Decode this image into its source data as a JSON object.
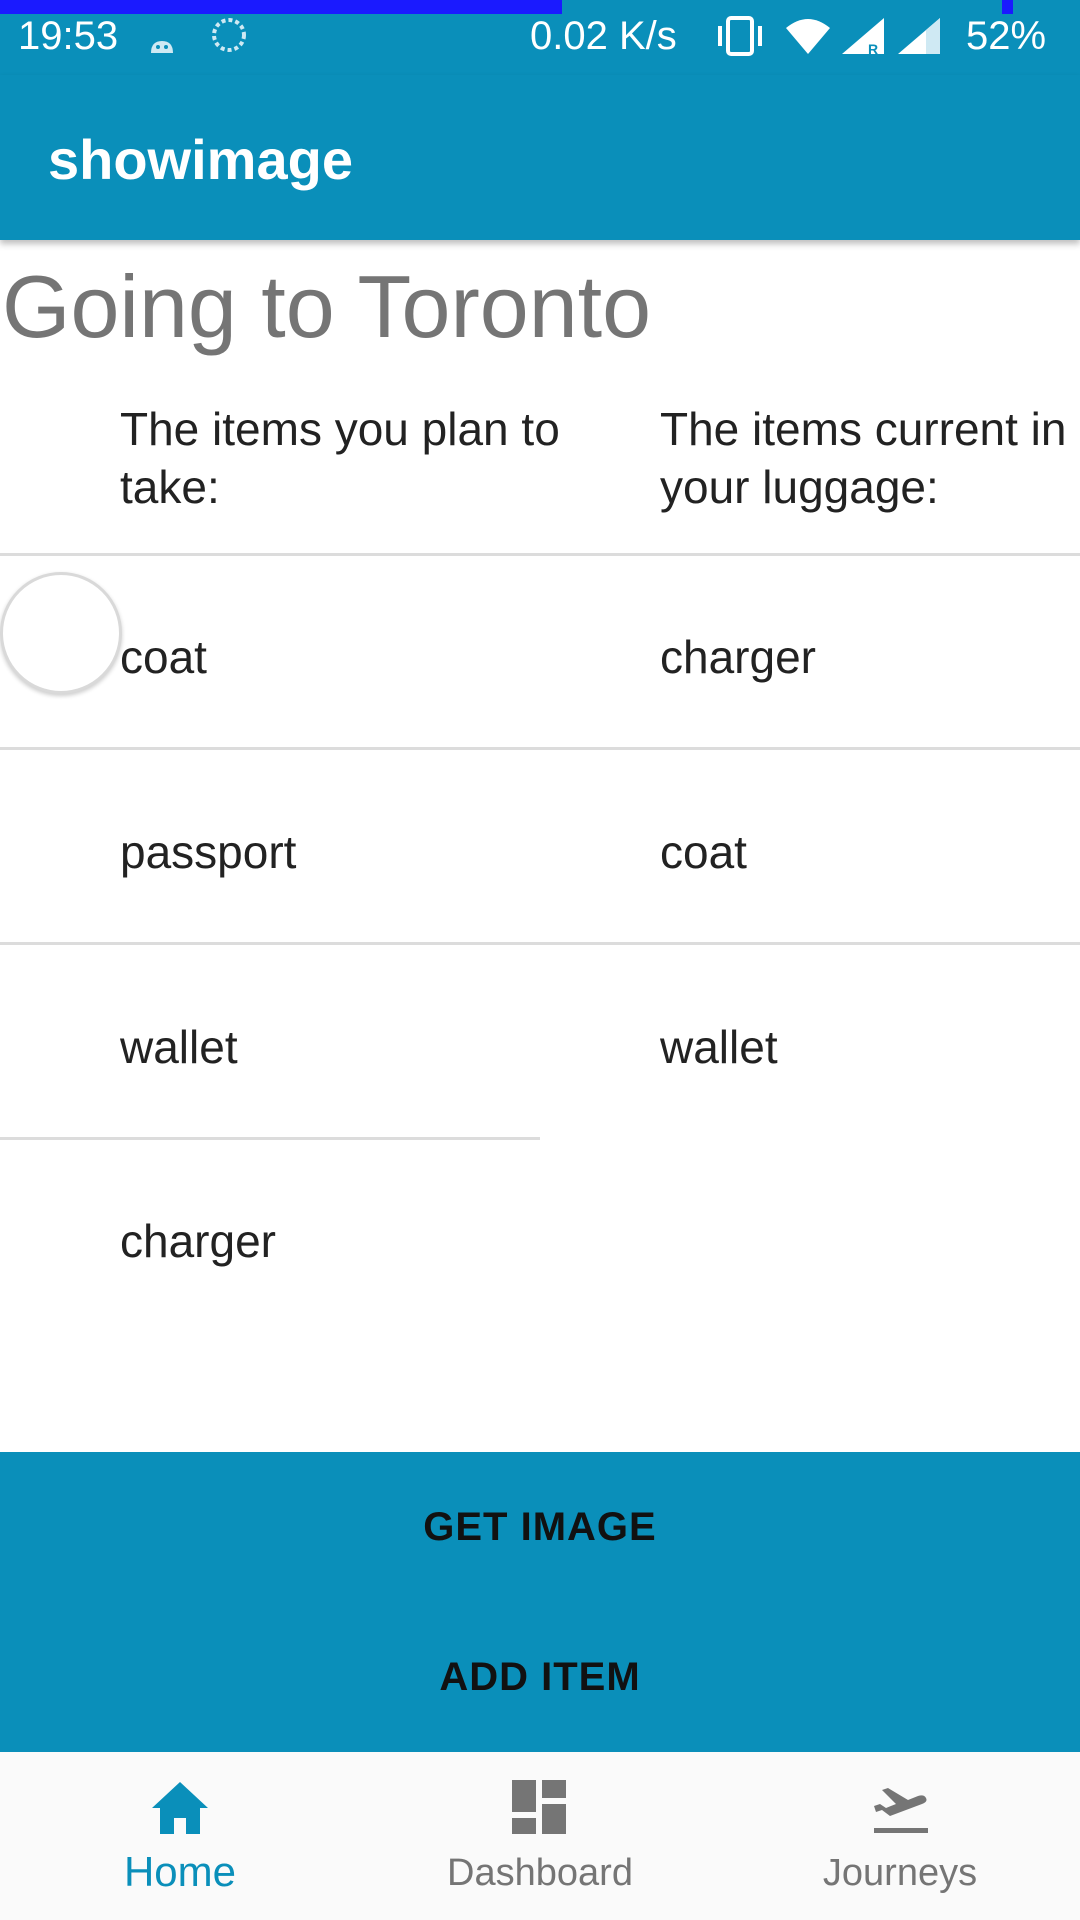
{
  "status_bar": {
    "time": "19:53",
    "network_speed": "0.02 K/s",
    "battery": "52%",
    "icons": [
      "android-icon",
      "sync-icon",
      "vibrate-icon",
      "wifi-icon",
      "signal-icon",
      "signal-roaming-icon"
    ],
    "progress_color": "#1a1aff"
  },
  "app_bar": {
    "title": "showimage",
    "color": "#0a8fba"
  },
  "page": {
    "heading": "Going to Toronto",
    "left_header": "The items you plan to take:",
    "right_header": "The items current in your luggage:",
    "planned_items": [
      "coat",
      "passport",
      "wallet",
      "charger"
    ],
    "luggage_items": [
      "charger",
      "coat",
      "wallet"
    ]
  },
  "buttons": {
    "get_image": "GET IMAGE",
    "add_item": "ADD ITEM"
  },
  "bottom_nav": {
    "active": "Home",
    "items": [
      {
        "label": "Home",
        "icon": "home-icon"
      },
      {
        "label": "Dashboard",
        "icon": "dashboard-icon"
      },
      {
        "label": "Journeys",
        "icon": "flight-takeoff-icon"
      }
    ]
  }
}
